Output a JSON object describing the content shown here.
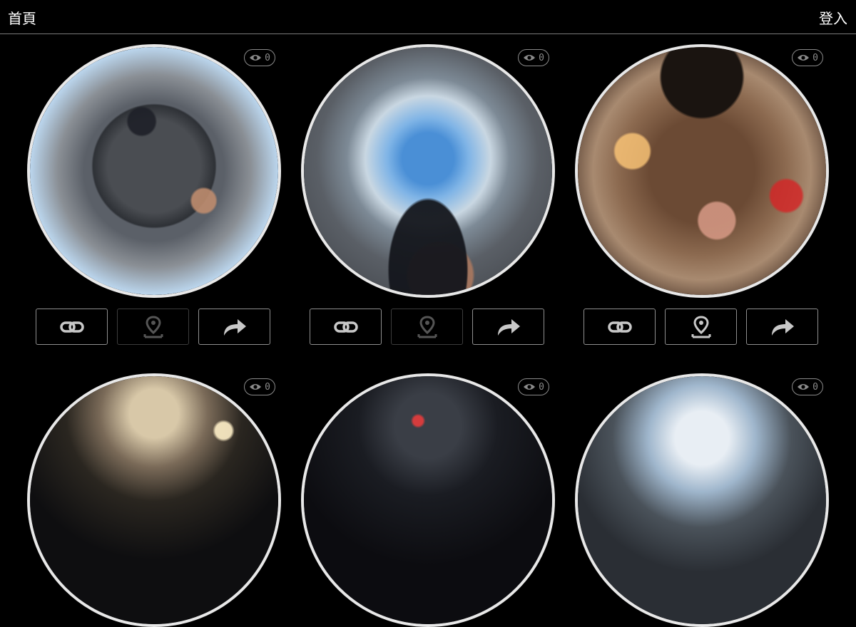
{
  "header": {
    "home_label": "首頁",
    "login_label": "登入"
  },
  "colors": {
    "background": "#000000",
    "border": "#7a7a7a",
    "button_border": "#8f8f8f",
    "disabled_border": "#3c3c3c",
    "icon": "#c8c8c8",
    "disabled_icon": "#555555"
  },
  "cards": [
    {
      "views": "0",
      "location_enabled": true,
      "location_disabled_style": true
    },
    {
      "views": "0",
      "location_disabled_style": true
    },
    {
      "views": "0",
      "location_disabled_style": false
    },
    {
      "views": "0"
    },
    {
      "views": "0"
    },
    {
      "views": "0"
    }
  ],
  "icons": {
    "views": "eye-icon",
    "link": "link-icon",
    "location": "location-pin-icon",
    "share": "share-arrow-icon"
  }
}
